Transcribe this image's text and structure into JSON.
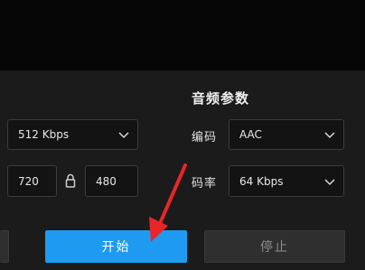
{
  "audio": {
    "section_title": "音频参数",
    "codec_label": "编码",
    "codec_value": "AAC",
    "bitrate_label": "码率",
    "bitrate_value": "64 Kbps"
  },
  "video": {
    "bitrate_value": "512 Kbps",
    "width_value": "720",
    "height_value": "480"
  },
  "actions": {
    "start_label": "开始",
    "stop_label": "停止"
  },
  "icons": {
    "lock": "lock-icon",
    "chevron": "chevron-down-icon",
    "pointer": "red-arrow"
  },
  "colors": {
    "accent": "#1e9bf0",
    "arrow": "#e8262a"
  }
}
